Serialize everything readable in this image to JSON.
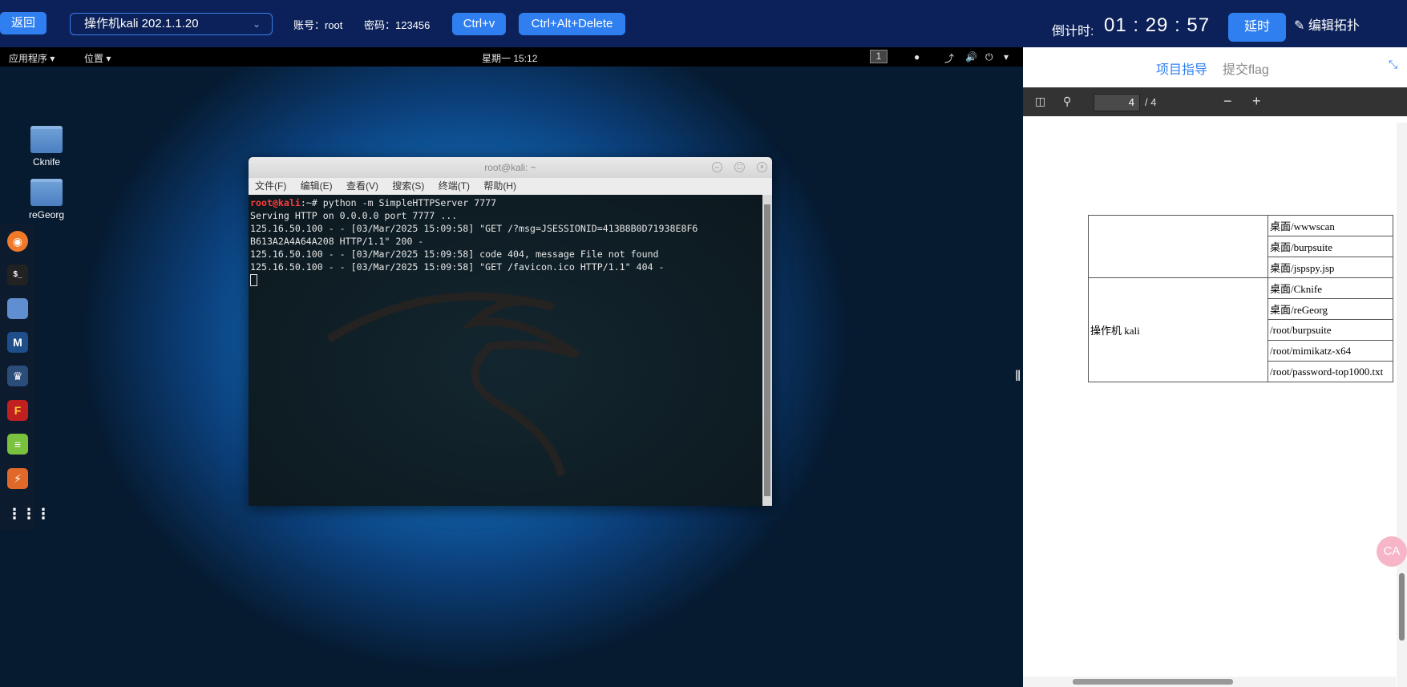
{
  "topbar": {
    "back_label": "返回",
    "machine": "操作机kali 202.1.1.20",
    "account": "账号：root",
    "password": "密码：123456",
    "ctrl_v": "Ctrl+v",
    "ctrl_alt_del": "Ctrl+Alt+Delete",
    "countdown_label": "倒计时:",
    "countdown": "01 : 29 : 57",
    "delay_label": "延时",
    "edit_topology": "编辑拓扑"
  },
  "kali": {
    "apps_menu": "应用程序 ▾",
    "places_menu": "位置 ▾",
    "clock": "星期一 15:12",
    "workspace": "1",
    "desktop_icons": [
      "Cknife",
      "reGeorg"
    ]
  },
  "terminal": {
    "title": "root@kali: ~",
    "menu": [
      "文件(F)",
      "编辑(E)",
      "查看(V)",
      "搜索(S)",
      "终端(T)",
      "帮助(H)"
    ],
    "prompt": "root@kali",
    "command": ":~# python -m SimpleHTTPServer 7777",
    "lines": [
      "Serving HTTP on 0.0.0.0 port 7777 ...",
      "125.16.50.100 - - [03/Mar/2025 15:09:58] \"GET /?msg=JSESSIONID=413B8B0D71938E8F6",
      "B613A2A4A64A208 HTTP/1.1\" 200 -",
      "125.16.50.100 - - [03/Mar/2025 15:09:58] code 404, message File not found",
      "125.16.50.100 - - [03/Mar/2025 15:09:58] \"GET /favicon.ico HTTP/1.1\" 404 -"
    ]
  },
  "rightpanel": {
    "tab_guide": "项目指导",
    "tab_flag": "提交flag",
    "page_current": "4",
    "page_total": "/ 4",
    "table": {
      "group_label": "操作机 kali",
      "rows_top": [
        "桌面/wwwscan",
        "桌面/burpsuite",
        "桌面/jspspy.jsp"
      ],
      "rows_kali": [
        "桌面/Cknife",
        "桌面/reGeorg",
        "/root/burpsuite",
        "/root/mimikatz-x64",
        "/root/password-top1000.txt"
      ]
    },
    "float_badge": "CA"
  }
}
